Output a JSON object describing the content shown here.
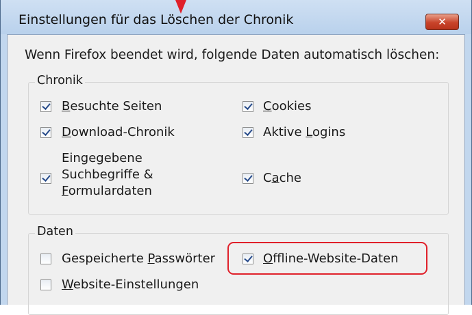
{
  "dialog": {
    "title": "Einstellungen für das Löschen der Chronik",
    "intro": "Wenn Firefox beendet wird, folgende Daten automatisch löschen:",
    "close_icon": "close-icon"
  },
  "groups": {
    "chronik": {
      "label": "Chronik",
      "items": [
        {
          "pre": "",
          "acc": "B",
          "post": "esuchte Seiten",
          "checked": true
        },
        {
          "pre": "",
          "acc": "D",
          "post": "ownload-Chronik",
          "checked": true
        },
        {
          "lines": [
            "Eingegebene",
            "Suchbegriffe &",
            "Formulardaten"
          ],
          "acc_line": 2,
          "acc": "F",
          "post": "ormulardaten",
          "checked": true
        },
        {
          "pre": "",
          "acc": "C",
          "post": "ookies",
          "checked": true
        },
        {
          "pre": "Aktive ",
          "acc": "L",
          "post": "ogins",
          "checked": true
        },
        {
          "pre": "C",
          "acc": "a",
          "post": "che",
          "checked": true
        }
      ]
    },
    "daten": {
      "label": "Daten",
      "items": [
        {
          "pre": "Gespeicherte ",
          "acc": "P",
          "post": "asswörter",
          "checked": false
        },
        {
          "pre": "",
          "acc": "W",
          "post": "ebsite-Einstellungen",
          "checked": false
        },
        {
          "pre": "",
          "acc": "O",
          "post": "ffline-Website-Daten",
          "checked": true
        }
      ]
    }
  },
  "colors": {
    "annotation": "#e0202a",
    "titlebar": "#c2d7ee",
    "close_button": "#c8432a"
  }
}
